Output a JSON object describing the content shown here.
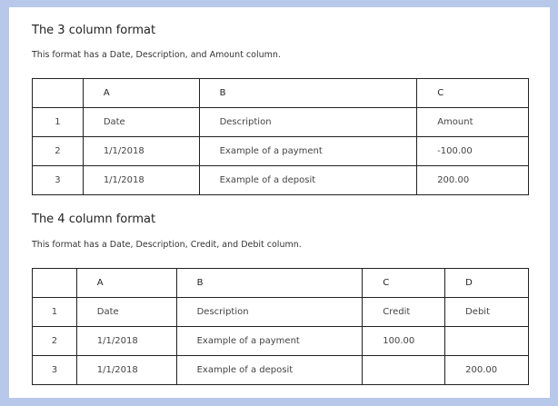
{
  "section1": {
    "title": "The 3 column format",
    "description": "This format has a Date, Description, and Amount column.",
    "columns": [
      "A",
      "B",
      "C"
    ],
    "rows": [
      {
        "index": "1",
        "cells": [
          "Date",
          "Description",
          "Amount"
        ]
      },
      {
        "index": "2",
        "cells": [
          "1/1/2018",
          "Example of a payment",
          "-100.00"
        ]
      },
      {
        "index": "3",
        "cells": [
          "1/1/2018",
          "Example of a deposit",
          "200.00"
        ]
      }
    ]
  },
  "section2": {
    "title": "The 4 column format",
    "description": "This format has a Date, Description, Credit, and Debit column.",
    "columns": [
      "A",
      "B",
      "C",
      "D"
    ],
    "rows": [
      {
        "index": "1",
        "cells": [
          "Date",
          "Description",
          "Credit",
          "Debit"
        ]
      },
      {
        "index": "2",
        "cells": [
          "1/1/2018",
          "Example of a payment",
          "100.00",
          ""
        ]
      },
      {
        "index": "3",
        "cells": [
          "1/1/2018",
          "Example of a deposit",
          "",
          "200.00"
        ]
      }
    ]
  }
}
